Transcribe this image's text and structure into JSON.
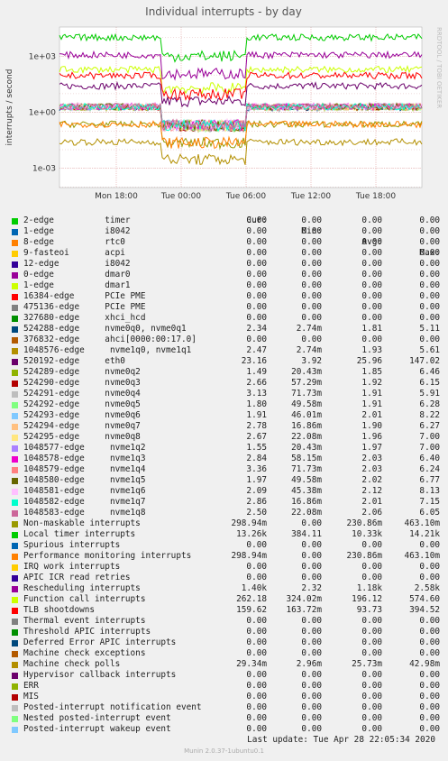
{
  "title": "Individual interrupts - by day",
  "side_text": "RRDTOOL / TOBI OETIKER",
  "chart_data": {
    "type": "line",
    "title": "Individual interrupts - by day",
    "ylabel": "interrupts / second",
    "yscale": "log",
    "yticks": [
      "1e+03",
      "1e+00",
      "1e-03"
    ],
    "xticks": [
      "Mon 18:00",
      "Tue 00:00",
      "Tue 06:00",
      "Tue 12:00",
      "Tue 18:00"
    ],
    "grid": true,
    "legend_position": "bottom",
    "series": [
      {
        "name": "2-edge",
        "device": "timer",
        "color": "#00cc00",
        "cur": "0.00",
        "min": "0.00",
        "avg": "0.00",
        "max": "0.00"
      },
      {
        "name": "1-edge",
        "device": "i8042",
        "color": "#0066b3",
        "cur": "0.00",
        "min": "0.00",
        "avg": "0.00",
        "max": "0.00"
      },
      {
        "name": "8-edge",
        "device": "rtc0",
        "color": "#ff8000",
        "cur": "0.00",
        "min": "0.00",
        "avg": "0.00",
        "max": "0.00"
      },
      {
        "name": "9-fasteoi",
        "device": "acpi",
        "color": "#ffcc00",
        "cur": "0.00",
        "min": "0.00",
        "avg": "0.00",
        "max": "0.00"
      },
      {
        "name": "12-edge",
        "device": "i8042",
        "color": "#330099",
        "cur": "0.00",
        "min": "0.00",
        "avg": "0.00",
        "max": "0.00"
      },
      {
        "name": "0-edge",
        "device": "dmar0",
        "color": "#990099",
        "cur": "0.00",
        "min": "0.00",
        "avg": "0.00",
        "max": "0.00"
      },
      {
        "name": "1-edge",
        "device": "dmar1",
        "color": "#ccff00",
        "cur": "0.00",
        "min": "0.00",
        "avg": "0.00",
        "max": "0.00"
      },
      {
        "name": "16384-edge",
        "device": "PCIe PME",
        "color": "#ff0000",
        "cur": "0.00",
        "min": "0.00",
        "avg": "0.00",
        "max": "0.00"
      },
      {
        "name": "475136-edge",
        "device": "PCIe PME",
        "color": "#808080",
        "cur": "0.00",
        "min": "0.00",
        "avg": "0.00",
        "max": "0.00"
      },
      {
        "name": "327680-edge",
        "device": "xhci_hcd",
        "color": "#008f00",
        "cur": "0.00",
        "min": "0.00",
        "avg": "0.00",
        "max": "0.00"
      },
      {
        "name": "524288-edge",
        "device": "nvme0q0, nvme0q1",
        "color": "#00487d",
        "cur": "2.34",
        "min": "2.74m",
        "avg": "1.81",
        "max": "5.11"
      },
      {
        "name": "376832-edge",
        "device": "ahci[0000:00:17.0]",
        "color": "#b35a00",
        "cur": "0.00",
        "min": "0.00",
        "avg": "0.00",
        "max": "0.00"
      },
      {
        "name": "1048576-edge",
        "device": "nvme1q0, nvme1q1",
        "color": "#b38f00",
        "cur": "2.47",
        "min": "2.74m",
        "avg": "1.93",
        "max": "5.61"
      },
      {
        "name": "520192-edge",
        "device": "eth0",
        "color": "#6b006b",
        "cur": "23.16",
        "min": "3.92",
        "avg": "25.96",
        "max": "147.02"
      },
      {
        "name": "524289-edge",
        "device": "nvme0q2",
        "color": "#8fb300",
        "cur": "1.49",
        "min": "20.43m",
        "avg": "1.85",
        "max": "6.46"
      },
      {
        "name": "524290-edge",
        "device": "nvme0q3",
        "color": "#b30000",
        "cur": "2.66",
        "min": "57.29m",
        "avg": "1.92",
        "max": "6.15"
      },
      {
        "name": "524291-edge",
        "device": "nvme0q4",
        "color": "#bebebe",
        "cur": "3.13",
        "min": "71.73m",
        "avg": "1.91",
        "max": "5.91"
      },
      {
        "name": "524292-edge",
        "device": "nvme0q5",
        "color": "#80ff80",
        "cur": "1.80",
        "min": "49.58m",
        "avg": "1.91",
        "max": "6.28"
      },
      {
        "name": "524293-edge",
        "device": "nvme0q6",
        "color": "#80c9ff",
        "cur": "1.91",
        "min": "46.01m",
        "avg": "2.01",
        "max": "8.22"
      },
      {
        "name": "524294-edge",
        "device": "nvme0q7",
        "color": "#ffc080",
        "cur": "2.78",
        "min": "16.86m",
        "avg": "1.90",
        "max": "6.27"
      },
      {
        "name": "524295-edge",
        "device": "nvme0q8",
        "color": "#ffe680",
        "cur": "2.67",
        "min": "22.08m",
        "avg": "1.96",
        "max": "7.00"
      },
      {
        "name": "1048577-edge",
        "device": "nvme1q2",
        "color": "#aa80ff",
        "cur": "1.55",
        "min": "20.43m",
        "avg": "1.97",
        "max": "7.00"
      },
      {
        "name": "1048578-edge",
        "device": "nvme1q3",
        "color": "#ee00cc",
        "cur": "2.84",
        "min": "58.15m",
        "avg": "2.03",
        "max": "6.40"
      },
      {
        "name": "1048579-edge",
        "device": "nvme1q4",
        "color": "#ff8080",
        "cur": "3.36",
        "min": "71.73m",
        "avg": "2.03",
        "max": "6.24"
      },
      {
        "name": "1048580-edge",
        "device": "nvme1q5",
        "color": "#666600",
        "cur": "1.97",
        "min": "49.58m",
        "avg": "2.02",
        "max": "6.77"
      },
      {
        "name": "1048581-edge",
        "device": "nvme1q6",
        "color": "#ffbfff",
        "cur": "2.09",
        "min": "45.38m",
        "avg": "2.12",
        "max": "8.13"
      },
      {
        "name": "1048582-edge",
        "device": "nvme1q7",
        "color": "#00ffcc",
        "cur": "2.86",
        "min": "16.86m",
        "avg": "2.01",
        "max": "7.15"
      },
      {
        "name": "1048583-edge",
        "device": "nvme1q8",
        "color": "#cc6699",
        "cur": "2.50",
        "min": "22.08m",
        "avg": "2.06",
        "max": "6.05"
      },
      {
        "name": "Non-maskable interrupts",
        "device": "",
        "color": "#999900",
        "cur": "298.94m",
        "min": "0.00",
        "avg": "230.86m",
        "max": "463.10m"
      },
      {
        "name": "Local timer interrupts",
        "device": "",
        "color": "#00cc00",
        "cur": "13.26k",
        "min": "384.11",
        "avg": "10.33k",
        "max": "14.21k"
      },
      {
        "name": "Spurious interrupts",
        "device": "",
        "color": "#0066b3",
        "cur": "0.00",
        "min": "0.00",
        "avg": "0.00",
        "max": "0.00"
      },
      {
        "name": "Performance monitoring interrupts",
        "device": "",
        "color": "#ff8000",
        "cur": "298.94m",
        "min": "0.00",
        "avg": "230.86m",
        "max": "463.10m"
      },
      {
        "name": "IRQ work interrupts",
        "device": "",
        "color": "#ffcc00",
        "cur": "0.00",
        "min": "0.00",
        "avg": "0.00",
        "max": "0.00"
      },
      {
        "name": "APIC ICR read retries",
        "device": "",
        "color": "#330099",
        "cur": "0.00",
        "min": "0.00",
        "avg": "0.00",
        "max": "0.00"
      },
      {
        "name": "Rescheduling interrupts",
        "device": "",
        "color": "#990099",
        "cur": "1.40k",
        "min": "2.32",
        "avg": "1.18k",
        "max": "2.58k"
      },
      {
        "name": "Function call interrupts",
        "device": "",
        "color": "#ccff00",
        "cur": "262.18",
        "min": "324.02m",
        "avg": "196.12",
        "max": "574.60"
      },
      {
        "name": "TLB shootdowns",
        "device": "",
        "color": "#ff0000",
        "cur": "159.62",
        "min": "163.72m",
        "avg": "93.73",
        "max": "394.52"
      },
      {
        "name": "Thermal event interrupts",
        "device": "",
        "color": "#808080",
        "cur": "0.00",
        "min": "0.00",
        "avg": "0.00",
        "max": "0.00"
      },
      {
        "name": "Threshold APIC interrupts",
        "device": "",
        "color": "#008f00",
        "cur": "0.00",
        "min": "0.00",
        "avg": "0.00",
        "max": "0.00"
      },
      {
        "name": "Deferred Error APIC interrupts",
        "device": "",
        "color": "#00487d",
        "cur": "0.00",
        "min": "0.00",
        "avg": "0.00",
        "max": "0.00"
      },
      {
        "name": "Machine check exceptions",
        "device": "",
        "color": "#b35a00",
        "cur": "0.00",
        "min": "0.00",
        "avg": "0.00",
        "max": "0.00"
      },
      {
        "name": "Machine check polls",
        "device": "",
        "color": "#b38f00",
        "cur": "29.34m",
        "min": "2.96m",
        "avg": "25.73m",
        "max": "42.98m"
      },
      {
        "name": "Hypervisor callback interrupts",
        "device": "",
        "color": "#6b006b",
        "cur": "0.00",
        "min": "0.00",
        "avg": "0.00",
        "max": "0.00"
      },
      {
        "name": "ERR",
        "device": "",
        "color": "#8fb300",
        "cur": "0.00",
        "min": "0.00",
        "avg": "0.00",
        "max": "0.00"
      },
      {
        "name": "MIS",
        "device": "",
        "color": "#b30000",
        "cur": "0.00",
        "min": "0.00",
        "avg": "0.00",
        "max": "0.00"
      },
      {
        "name": "Posted-interrupt notification event",
        "device": "",
        "color": "#bebebe",
        "cur": "0.00",
        "min": "0.00",
        "avg": "0.00",
        "max": "0.00"
      },
      {
        "name": "Nested posted-interrupt event",
        "device": "",
        "color": "#80ff80",
        "cur": "0.00",
        "min": "0.00",
        "avg": "0.00",
        "max": "0.00"
      },
      {
        "name": "Posted-interrupt wakeup event",
        "device": "",
        "color": "#80c9ff",
        "cur": "0.00",
        "min": "0.00",
        "avg": "0.00",
        "max": "0.00"
      }
    ]
  },
  "legend_header": {
    "cur": "Cur:",
    "min": "Min:",
    "avg": "Avg:",
    "max": "Max:"
  },
  "footer": {
    "last_update": "Last update: Tue Apr 28 22:05:34 2020",
    "version": "Munin 2.0.37-1ubuntu0.1"
  }
}
